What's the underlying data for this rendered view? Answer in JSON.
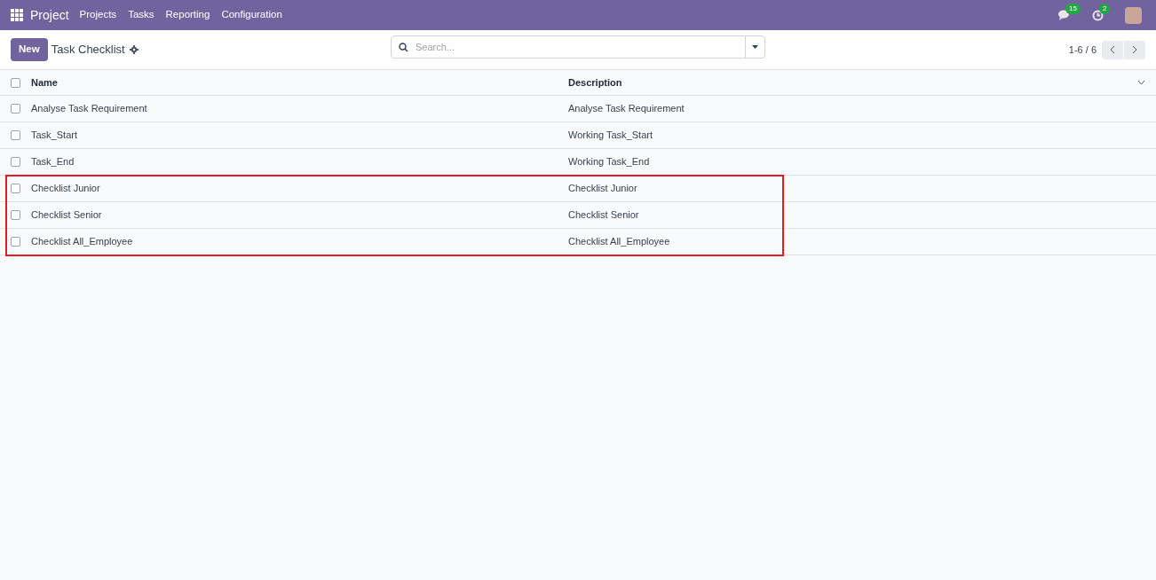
{
  "navbar": {
    "app": "Project",
    "menu": [
      "Projects",
      "Tasks",
      "Reporting",
      "Configuration"
    ],
    "messages_count": "15",
    "activities_count": "2"
  },
  "control_panel": {
    "new_button": "New",
    "title": "Task Checklist",
    "search": {
      "placeholder": "Search..."
    },
    "pager": "1-6 / 6"
  },
  "table": {
    "select_all_checked": false,
    "columns": [
      "Name",
      "Description"
    ],
    "rows": [
      {
        "name": "Analyse Task Requirement",
        "description": "Analyse Task Requirement",
        "checked": false,
        "highlighted": false
      },
      {
        "name": "Task_Start",
        "description": "Working Task_Start",
        "checked": false,
        "highlighted": false
      },
      {
        "name": "Task_End",
        "description": "Working Task_End",
        "checked": false,
        "highlighted": false
      },
      {
        "name": "Checklist Junior",
        "description": "Checklist Junior",
        "checked": false,
        "highlighted": true
      },
      {
        "name": "Checklist Senior",
        "description": "Checklist Senior",
        "checked": false,
        "highlighted": true
      },
      {
        "name": "Checklist All_Employee",
        "description": "Checklist All_Employee",
        "checked": false,
        "highlighted": true
      }
    ]
  }
}
